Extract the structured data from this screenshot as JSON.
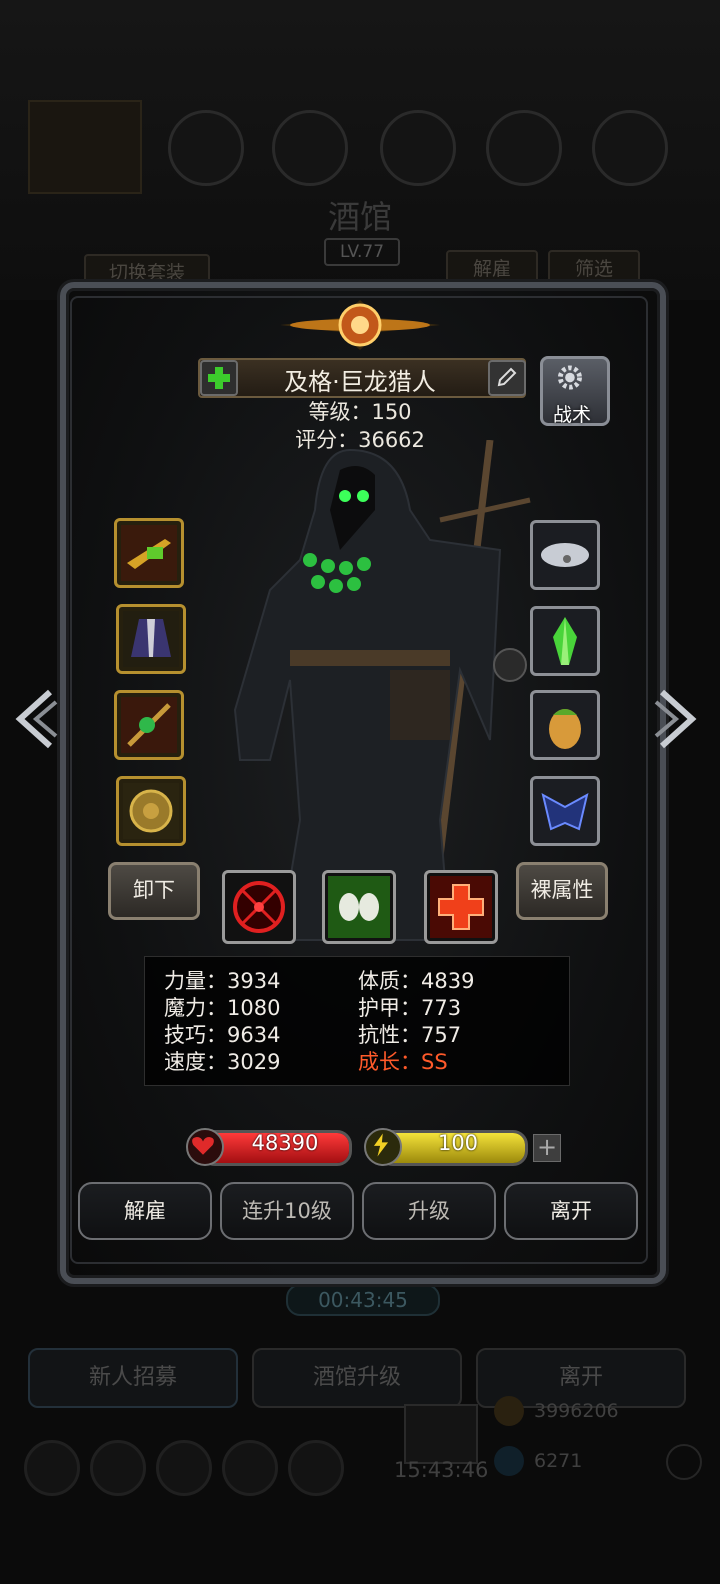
{
  "background": {
    "tavern_title": "酒馆",
    "tavern_level": "LV.77",
    "switch_outfit_label": "切换套装",
    "dismiss_label": "解雇",
    "filter_label": "筛选",
    "timer": "00:43:45",
    "recruit_label": "新人招募",
    "upgrade_tavern_label": "酒馆升级",
    "leave_label": "离开",
    "gold": "3996206",
    "clock": "15:43:46",
    "gems": "6271"
  },
  "hero": {
    "name": "及格·巨龙猎人",
    "level_text": "等级：150",
    "score_text": "评分：36662",
    "tactics_label": "战术",
    "unequip_label": "卸下",
    "naked_stats_label": "裸属性"
  },
  "equipment": {
    "left": [
      "gun-icon",
      "coat-icon",
      "staff-icon",
      "shield-icon"
    ],
    "right": [
      "cloud-icon",
      "crystal-icon",
      "egg-icon",
      "mask-icon"
    ]
  },
  "skills": [
    "crosshair-skill-icon",
    "skulls-skill-icon",
    "medic-cross-skill-icon"
  ],
  "stats": {
    "left": [
      "力量：3934",
      "魔力：1080",
      "技巧：9634",
      "速度：3029"
    ],
    "right": [
      "体质：4839",
      "护甲：773",
      "抗性：757",
      "成长：SS"
    ]
  },
  "bars": {
    "hp": "48390",
    "energy": "100",
    "hp_color": "#c8161c",
    "energy_color": "#d8c21a"
  },
  "actions": {
    "dismiss": "解雇",
    "level_up_10": "连升10级",
    "level_up": "升级",
    "leave": "离开"
  },
  "colors": {
    "growth": "#ff5a2a",
    "gold_frame": "#b6902f",
    "silver_frame": "#8d9096"
  }
}
